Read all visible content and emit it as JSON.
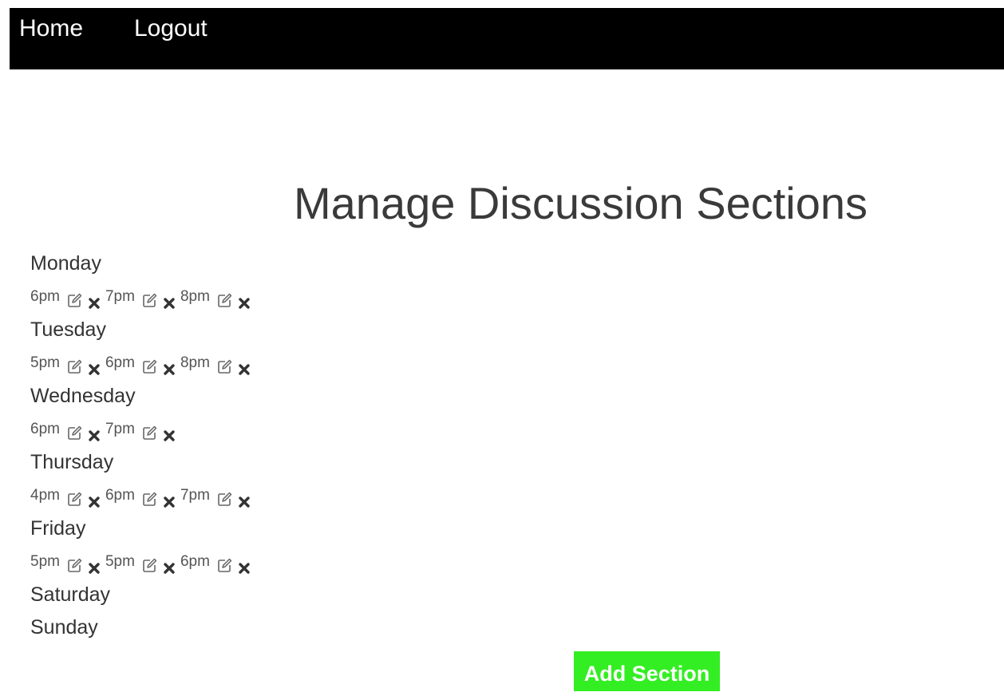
{
  "nav": {
    "home_label": "Home",
    "logout_label": "Logout"
  },
  "page": {
    "title": "Manage Discussion Sections"
  },
  "days": [
    {
      "name": "Monday",
      "sections": [
        "6pm",
        "7pm",
        "8pm"
      ]
    },
    {
      "name": "Tuesday",
      "sections": [
        "5pm",
        "6pm",
        "8pm"
      ]
    },
    {
      "name": "Wednesday",
      "sections": [
        "6pm",
        "7pm"
      ]
    },
    {
      "name": "Thursday",
      "sections": [
        "4pm",
        "6pm",
        "7pm"
      ]
    },
    {
      "name": "Friday",
      "sections": [
        "5pm",
        "5pm",
        "6pm"
      ]
    },
    {
      "name": "Saturday",
      "sections": []
    },
    {
      "name": "Sunday",
      "sections": []
    }
  ],
  "actions": {
    "add_section_label": "Add Section"
  },
  "icons": {
    "edit": "edit-icon",
    "delete": "delete-icon"
  },
  "colors": {
    "navbar": "#000000",
    "add_button": "#33ee22"
  }
}
